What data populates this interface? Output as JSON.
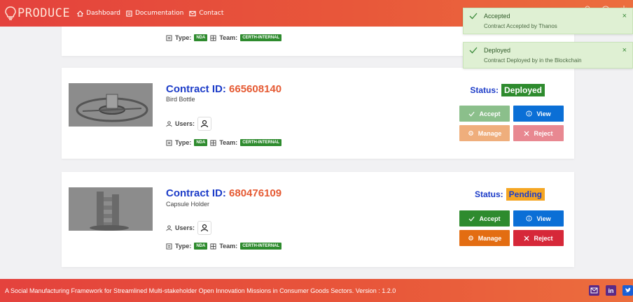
{
  "header": {
    "logo_text": "PRODUCE",
    "nav": [
      {
        "label": "Dashboard",
        "icon": "home-icon"
      },
      {
        "label": "Documentation",
        "icon": "document-icon"
      },
      {
        "label": "Contact",
        "icon": "mail-icon"
      }
    ]
  },
  "contracts": [
    {
      "type_label": "Type:",
      "type_badge": "NDA",
      "team_label": "Team:",
      "team_badge": "CERTH-INTERNAL"
    },
    {
      "id_label": "Contract ID:",
      "id": "665608140",
      "name": "Bird Bottle",
      "users_label": "Users:",
      "type_label": "Type:",
      "type_badge": "NDA",
      "team_label": "Team:",
      "team_badge": "CERTH-INTERNAL",
      "status_label": "Status:",
      "status": "Deployed",
      "buttons": {
        "accept": "Accept",
        "view": "View",
        "manage": "Manage",
        "reject": "Reject"
      }
    },
    {
      "id_label": "Contract ID:",
      "id": "680476109",
      "name": "Capsule Holder",
      "users_label": "Users:",
      "type_label": "Type:",
      "type_badge": "NDA",
      "team_label": "Team:",
      "team_badge": "CERTH-INTERNAL",
      "status_label": "Status:",
      "status": "Pending",
      "buttons": {
        "accept": "Accept",
        "view": "View",
        "manage": "Manage",
        "reject": "Reject"
      }
    }
  ],
  "toasts": [
    {
      "title": "Accepted",
      "message": "Contract Accepted by Thanos",
      "close": "×"
    },
    {
      "title": "Deployed",
      "message": "Contract Deployed by in the Blockchain",
      "close": "×"
    }
  ],
  "footer": {
    "text": "A Social Manufacturing Framework for Streamlined Multi-stakeholder Open Innovation Missions in Consumer Goods Sectors. Version : 1.2.0",
    "social": [
      "email",
      "linkedin",
      "twitter"
    ]
  },
  "colors": {
    "brand": "#e4423d",
    "contract_id": "#1c3cc8",
    "contract_num": "#e55a33",
    "deployed": "#2e8b2e",
    "pending": "#f5a623",
    "view": "#0b6fd6",
    "manage": "#e36d12",
    "reject": "#d62839"
  }
}
